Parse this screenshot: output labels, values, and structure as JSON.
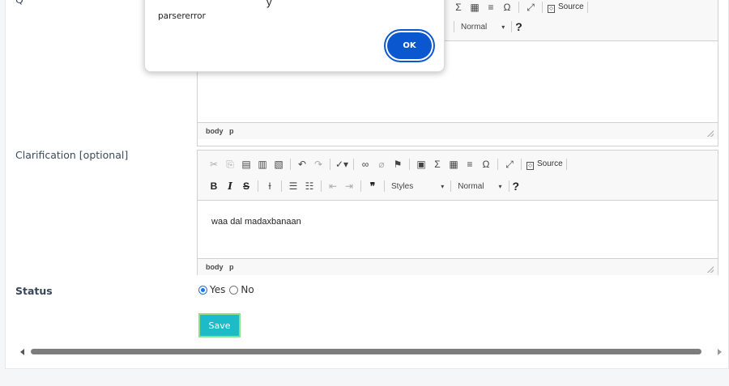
{
  "form": {
    "question_label_fragment": "Q",
    "clarification_label": "Clarification [optional]",
    "status_label": "Status",
    "status_options": [
      {
        "label": "Yes",
        "selected": true
      },
      {
        "label": "No",
        "selected": false
      }
    ],
    "save_label": "Save"
  },
  "editor1": {
    "toolbar_row1_visible": {
      "source_label": "Source"
    },
    "toolbar_row2_visible": {
      "format_value": "Normal",
      "help_label": "?"
    },
    "content": "",
    "path": [
      "body",
      "p"
    ]
  },
  "editor2": {
    "toolbar": {
      "source_label": "Source",
      "styles_value": "Styles",
      "format_value": "Normal",
      "help_label": "?",
      "bold_label": "B",
      "italic_label": "I",
      "strike_label": "S"
    },
    "content": "waa dal madaxbanaan",
    "path": [
      "body",
      "p"
    ]
  },
  "dialog": {
    "title_fragment": "y",
    "message": "parsererror",
    "ok_label": "OK"
  },
  "colors": {
    "save_button": "#1bbbc9",
    "dialog_ok": "#0b57d0",
    "radio_accent": "#1a73e8"
  }
}
